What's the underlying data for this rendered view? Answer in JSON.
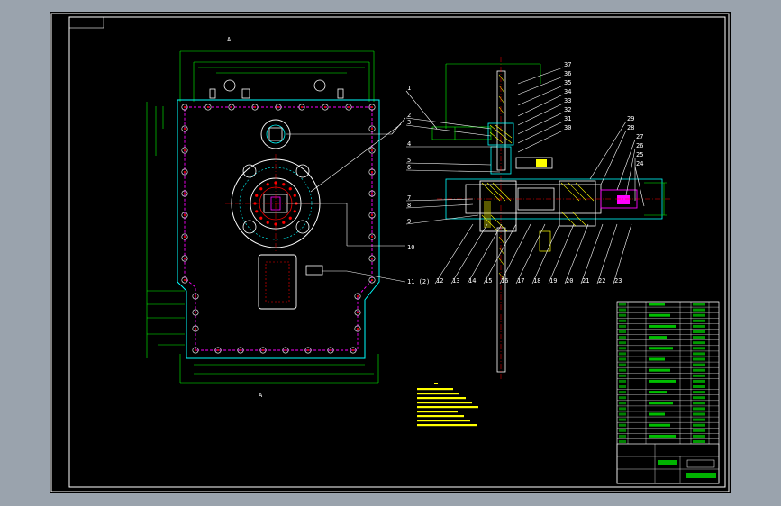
{
  "drawing": {
    "background": "#000000",
    "frame_color": "#ffffff",
    "colors": {
      "outline": "#00ffff",
      "dimension": "#00ff00",
      "hidden": "#ff00ff",
      "leader": "#ffffff",
      "section": "#ffff00",
      "bolt": "#ff0000"
    },
    "section_marks": {
      "top": "A",
      "bottom": "A"
    },
    "balloons_right": [
      "37",
      "36",
      "35",
      "34",
      "33",
      "32",
      "31",
      "30",
      "29",
      "28",
      "27",
      "26",
      "25",
      "24"
    ],
    "balloons_left": [
      "1",
      "2",
      "3",
      "4",
      "5",
      "6",
      "7",
      "8",
      "9"
    ],
    "balloons_bottom": [
      "12",
      "13",
      "14",
      "15",
      "16",
      "17",
      "18",
      "19",
      "20",
      "21",
      "22",
      "23"
    ],
    "balloon_10": "10",
    "balloon_11": "11 (2)"
  }
}
